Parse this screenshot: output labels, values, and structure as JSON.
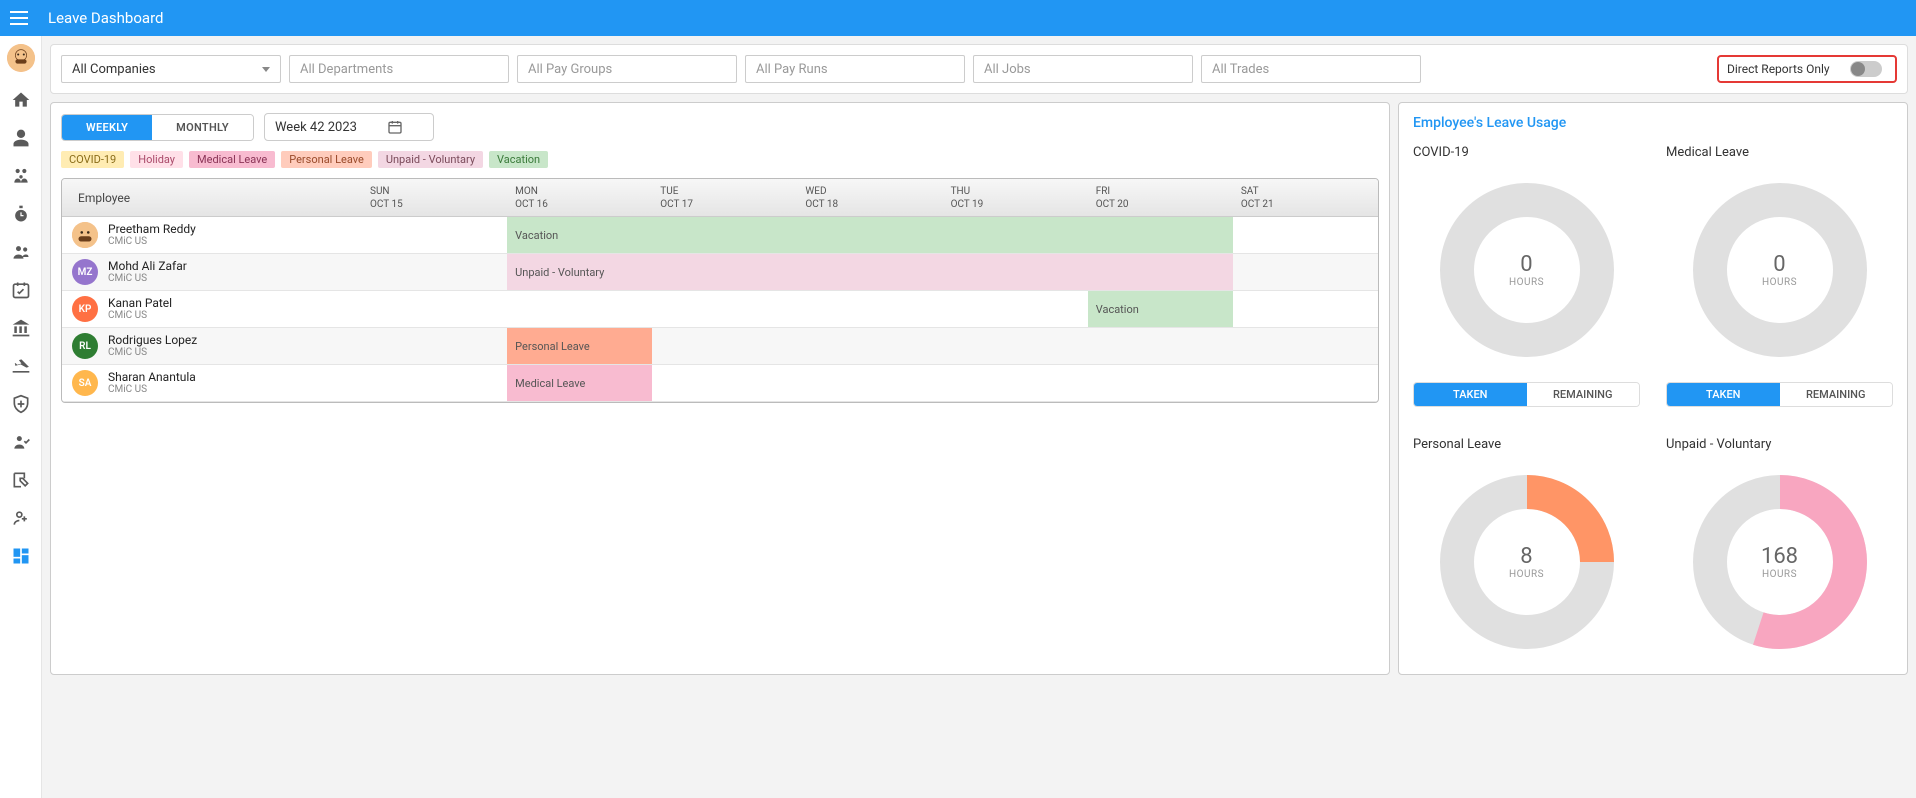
{
  "header": {
    "title": "Leave Dashboard"
  },
  "filters": {
    "company": {
      "value": "All Companies"
    },
    "departments": {
      "placeholder": "All Departments"
    },
    "pay_groups": {
      "placeholder": "All Pay Groups"
    },
    "pay_runs": {
      "placeholder": "All Pay Runs"
    },
    "jobs": {
      "placeholder": "All Jobs"
    },
    "trades": {
      "placeholder": "All Trades"
    },
    "direct_reports_label": "Direct Reports Only"
  },
  "view": {
    "weekly_label": "WEEKLY",
    "monthly_label": "MONTHLY",
    "week_value": "Week 42 2023"
  },
  "legend": {
    "covid": "COVID-19",
    "holiday": "Holiday",
    "medical": "Medical Leave",
    "personal": "Personal Leave",
    "unpaid": "Unpaid - Voluntary",
    "vacation": "Vacation"
  },
  "calendar": {
    "employee_header": "Employee",
    "days": [
      {
        "dow": "SUN",
        "date": "OCT 15"
      },
      {
        "dow": "MON",
        "date": "OCT 16"
      },
      {
        "dow": "TUE",
        "date": "OCT 17"
      },
      {
        "dow": "WED",
        "date": "OCT 18"
      },
      {
        "dow": "THU",
        "date": "OCT 19"
      },
      {
        "dow": "FRI",
        "date": "OCT 20"
      },
      {
        "dow": "SAT",
        "date": "OCT 21"
      }
    ],
    "rows": [
      {
        "name": "Preetham Reddy",
        "company": "CMiC US",
        "avatar": {
          "type": "image",
          "initials": ""
        },
        "leaves": [
          {
            "type": "vacation",
            "label": "Vacation",
            "start": 1,
            "span": 5
          }
        ]
      },
      {
        "name": "Mohd Ali Zafar",
        "company": "CMiC US",
        "avatar": {
          "type": "initials",
          "initials": "MZ"
        },
        "leaves": [
          {
            "type": "unpaid",
            "label": "Unpaid - Voluntary",
            "start": 1,
            "span": 5
          }
        ]
      },
      {
        "name": "Kanan Patel",
        "company": "CMiC US",
        "avatar": {
          "type": "initials",
          "initials": "KP"
        },
        "leaves": [
          {
            "type": "vacation",
            "label": "Vacation",
            "start": 5,
            "span": 1
          }
        ]
      },
      {
        "name": "Rodrigues Lopez",
        "company": "CMiC US",
        "avatar": {
          "type": "initials",
          "initials": "RL"
        },
        "leaves": [
          {
            "type": "personal",
            "label": "Personal Leave",
            "start": 1,
            "span": 1
          }
        ]
      },
      {
        "name": "Sharan Anantula",
        "company": "CMiC US",
        "avatar": {
          "type": "initials",
          "initials": "SA"
        },
        "leaves": [
          {
            "type": "medical",
            "label": "Medical Leave",
            "start": 1,
            "span": 1
          }
        ]
      }
    ]
  },
  "usage": {
    "title": "Employee's Leave Usage",
    "taken_label": "TAKEN",
    "remaining_label": "REMAINING",
    "hours_label": "HOURS",
    "cards": [
      {
        "title": "COVID-19",
        "value": "0",
        "pct": 0,
        "color": "#e0e0e0",
        "toggle": true
      },
      {
        "title": "Medical Leave",
        "value": "0",
        "pct": 0,
        "color": "#e0e0e0",
        "toggle": true
      },
      {
        "title": "Personal Leave",
        "value": "8",
        "pct": 25,
        "color": "#ff9566",
        "toggle": false
      },
      {
        "title": "Unpaid - Voluntary",
        "value": "168",
        "pct": 55,
        "color": "#f8a6c0",
        "toggle": false
      }
    ]
  },
  "chart_data": [
    {
      "type": "pie",
      "title": "COVID-19",
      "series": [
        {
          "name": "Taken",
          "value": 0
        },
        {
          "name": "Remaining",
          "value": 100
        }
      ],
      "units": "HOURS",
      "center_value": 0
    },
    {
      "type": "pie",
      "title": "Medical Leave",
      "series": [
        {
          "name": "Taken",
          "value": 0
        },
        {
          "name": "Remaining",
          "value": 100
        }
      ],
      "units": "HOURS",
      "center_value": 0
    },
    {
      "type": "pie",
      "title": "Personal Leave",
      "series": [
        {
          "name": "Taken",
          "value": 25
        },
        {
          "name": "Remaining",
          "value": 75
        }
      ],
      "units": "HOURS",
      "center_value": 8
    },
    {
      "type": "pie",
      "title": "Unpaid - Voluntary",
      "series": [
        {
          "name": "Taken",
          "value": 55
        },
        {
          "name": "Remaining",
          "value": 45
        }
      ],
      "units": "HOURS",
      "center_value": 168
    }
  ]
}
